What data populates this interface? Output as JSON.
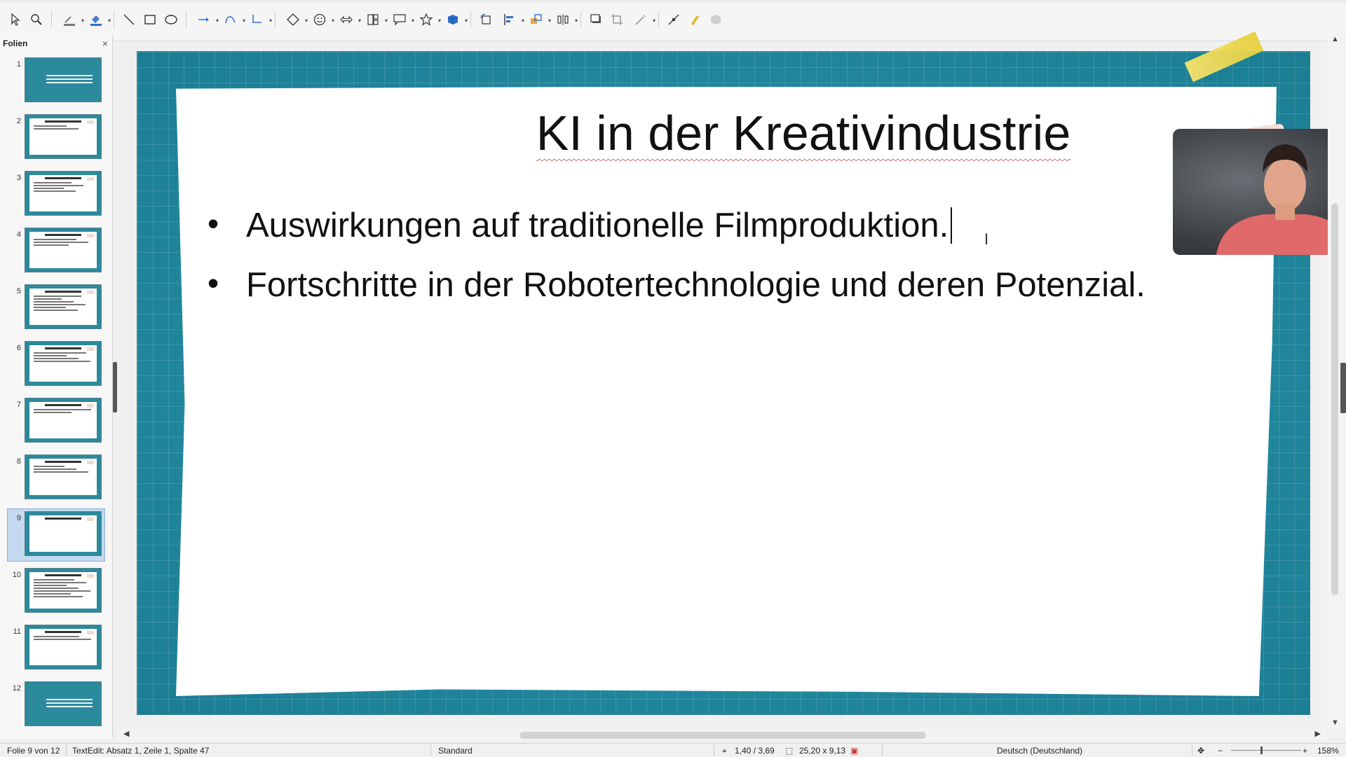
{
  "app": {
    "accent": "#1d8aa1"
  },
  "toolbar": {
    "tools": [
      "select-icon",
      "zoom-icon",
      "line-color-icon",
      "fill-color-icon",
      "line-icon",
      "rectangle-icon",
      "ellipse-icon",
      "arrow-icon",
      "curve-icon",
      "connector-icon",
      "diamond-icon",
      "smiley-icon",
      "double-arrow-icon",
      "flowchart-icon",
      "callout-icon",
      "star-icon",
      "3d-object-icon",
      "rotate-icon",
      "align-icon",
      "arrange-icon",
      "distribute-icon",
      "shadow-icon",
      "crop-icon",
      "filter-icon",
      "points-icon",
      "glue-icon",
      "toggle-extrusion-icon"
    ]
  },
  "panel": {
    "title": "Folien",
    "close_label": "×",
    "slides": [
      {
        "number": "1",
        "kind": "cover"
      },
      {
        "number": "2",
        "kind": "content",
        "lines": 2
      },
      {
        "number": "3",
        "kind": "content",
        "lines": 4
      },
      {
        "number": "4",
        "kind": "content",
        "lines": 3
      },
      {
        "number": "5",
        "kind": "content",
        "lines": 6
      },
      {
        "number": "6",
        "kind": "content",
        "lines": 4
      },
      {
        "number": "7",
        "kind": "content",
        "lines": 2
      },
      {
        "number": "8",
        "kind": "content",
        "lines": 3
      },
      {
        "number": "9",
        "kind": "content",
        "lines": 0,
        "active": true
      },
      {
        "number": "10",
        "kind": "content",
        "lines": 7
      },
      {
        "number": "11",
        "kind": "content",
        "lines": 2
      },
      {
        "number": "12",
        "kind": "cover"
      }
    ]
  },
  "slide": {
    "title": "KI in der Kreativindustrie",
    "bullets": [
      "Auswirkungen auf traditionelle Filmproduktion.",
      "Fortschritte in der Robotertechnologie und deren Potenzial."
    ]
  },
  "status": {
    "slide_of": "Folie 9 von 12",
    "edit_info": "TextEdit: Absatz 1, Zeile 1, Spalte 47",
    "layout": "Standard",
    "position": "1,40 / 3,69",
    "size": "25,20 x 9,13",
    "language": "Deutsch (Deutschland)",
    "zoom": "158%"
  }
}
